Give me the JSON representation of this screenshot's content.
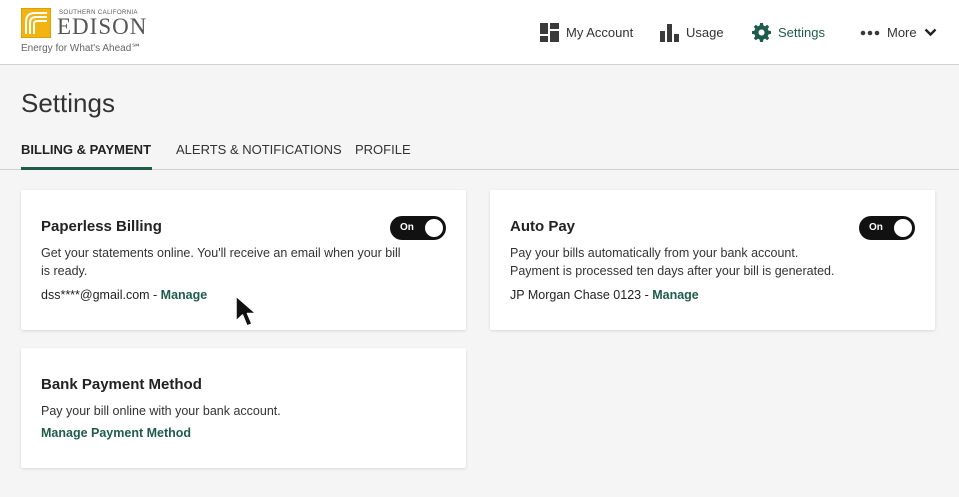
{
  "brand": {
    "small_line": "SOUTHERN CALIFORNIA",
    "name": "EDISON",
    "tagline": "Energy for What's Ahead℠",
    "colors": {
      "gold": "#f2b411",
      "accent": "#1f5c4b"
    }
  },
  "nav": {
    "items": [
      {
        "label": "My Account",
        "icon": "dashboard-icon"
      },
      {
        "label": "Usage",
        "icon": "bar-chart-icon"
      },
      {
        "label": "Settings",
        "icon": "gear-icon",
        "active": true
      },
      {
        "label": "More",
        "icon": "ellipsis-icon"
      }
    ]
  },
  "page": {
    "title": "Settings"
  },
  "tabs": [
    {
      "label": "BILLING & PAYMENT",
      "active": true
    },
    {
      "label": "ALERTS & NOTIFICATIONS",
      "active": false
    },
    {
      "label": "PROFILE",
      "active": false
    }
  ],
  "paperless": {
    "title": "Paperless Billing",
    "toggle_label": "On",
    "description": "Get your statements online. You'll receive an email when your bill is ready.",
    "email": "dss****@gmail.com",
    "separator": " - ",
    "link": "Manage"
  },
  "autopay": {
    "title": "Auto Pay",
    "toggle_label": "On",
    "description_line1": "Pay your bills automatically from your bank account.",
    "description_line2": "Payment is processed ten days after your bill is generated.",
    "account": "JP Morgan Chase 0123",
    "separator": " - ",
    "link": "Manage"
  },
  "bank": {
    "title": "Bank Payment Method",
    "description": "Pay your bill online with your bank account.",
    "link": "Manage Payment Method"
  }
}
